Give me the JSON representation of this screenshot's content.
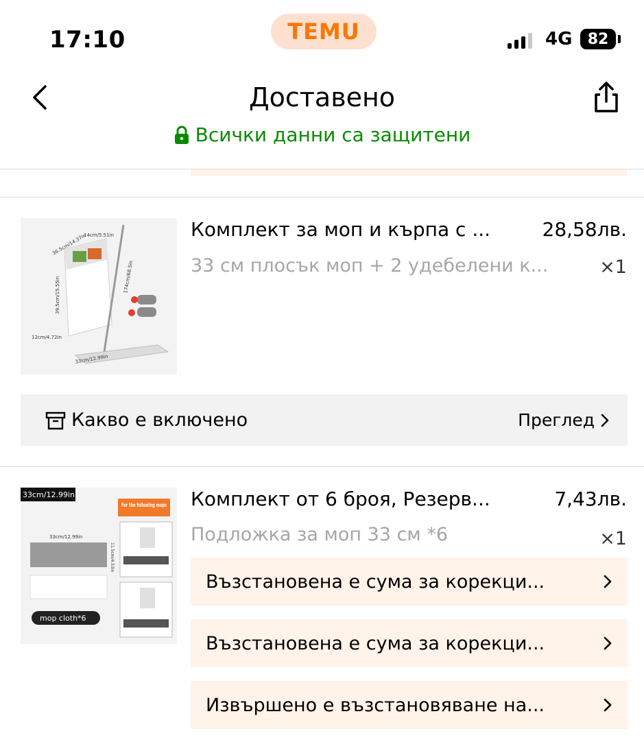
{
  "status_bar": {
    "time": "17:10",
    "app_badge": "TEMU",
    "network": "4G",
    "battery": "82"
  },
  "header": {
    "title": "Доставено",
    "secure_text": "Всички данни са защитени"
  },
  "items": [
    {
      "title": "Комплект за моп и кърпа с ...",
      "price": "28,58лв.",
      "variant": "33 см плосък моп + 2 удебелени к...",
      "qty": "×1",
      "image_labels": [
        "14cm/5.51in",
        "36.5cm/14.37in",
        "174cm/68.5in",
        "39.5cm/15.55in",
        "12cm/4.72in",
        "33cm/12.99in"
      ]
    },
    {
      "title": "Комплект от 6 броя, Резерв...",
      "price": "7,43лв.",
      "variant": "Подложка за моп 33 см *6",
      "qty": "×1",
      "image_labels": [
        "33cm/12.99in",
        "For the following mops",
        "33cm/12.99in",
        "11.5cm/4.53in",
        "mop cloth*6"
      ]
    }
  ],
  "included": {
    "label": "Какво е включено",
    "action": "Преглед"
  },
  "notices": [
    "Възстановена е сума за корекци...",
    "Възстановена е сума за корекци...",
    "Извършено е възстановяване на..."
  ],
  "colors": {
    "brand": "#fb7701",
    "secure_green": "#0a8a00",
    "notice_bg": "#fff3ea"
  }
}
